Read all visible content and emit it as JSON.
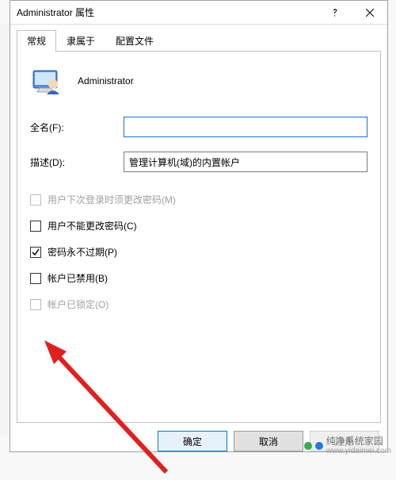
{
  "window": {
    "title": "Administrator 属性",
    "help_icon": "help-icon",
    "close_icon": "close-icon"
  },
  "tabs": [
    {
      "label": "常规",
      "active": true
    },
    {
      "label": "隶属于",
      "active": false
    },
    {
      "label": "配置文件",
      "active": false
    }
  ],
  "header": {
    "username": "Administrator"
  },
  "fields": {
    "fullname_label": "全名(F):",
    "fullname_value": "",
    "description_label": "描述(D):",
    "description_value": "管理计算机(域)的内置帐户"
  },
  "checkboxes": [
    {
      "key": "must_change",
      "label": "用户下次登录时须更改密码(M)",
      "checked": false,
      "disabled": true
    },
    {
      "key": "cannot_change",
      "label": "用户不能更改密码(C)",
      "checked": false,
      "disabled": false
    },
    {
      "key": "never_expire",
      "label": "密码永不过期(P)",
      "checked": true,
      "disabled": false
    },
    {
      "key": "disabled_acct",
      "label": "帐户已禁用(B)",
      "checked": false,
      "disabled": false
    },
    {
      "key": "locked",
      "label": "帐户已锁定(O)",
      "checked": false,
      "disabled": true
    }
  ],
  "buttons": {
    "ok": "确定",
    "cancel": "取消",
    "apply": "应用"
  },
  "watermark": {
    "text": "纯净系统家园",
    "url": "www.yidaimei.com"
  },
  "annotation": {
    "arrow_color": "#e02020"
  }
}
